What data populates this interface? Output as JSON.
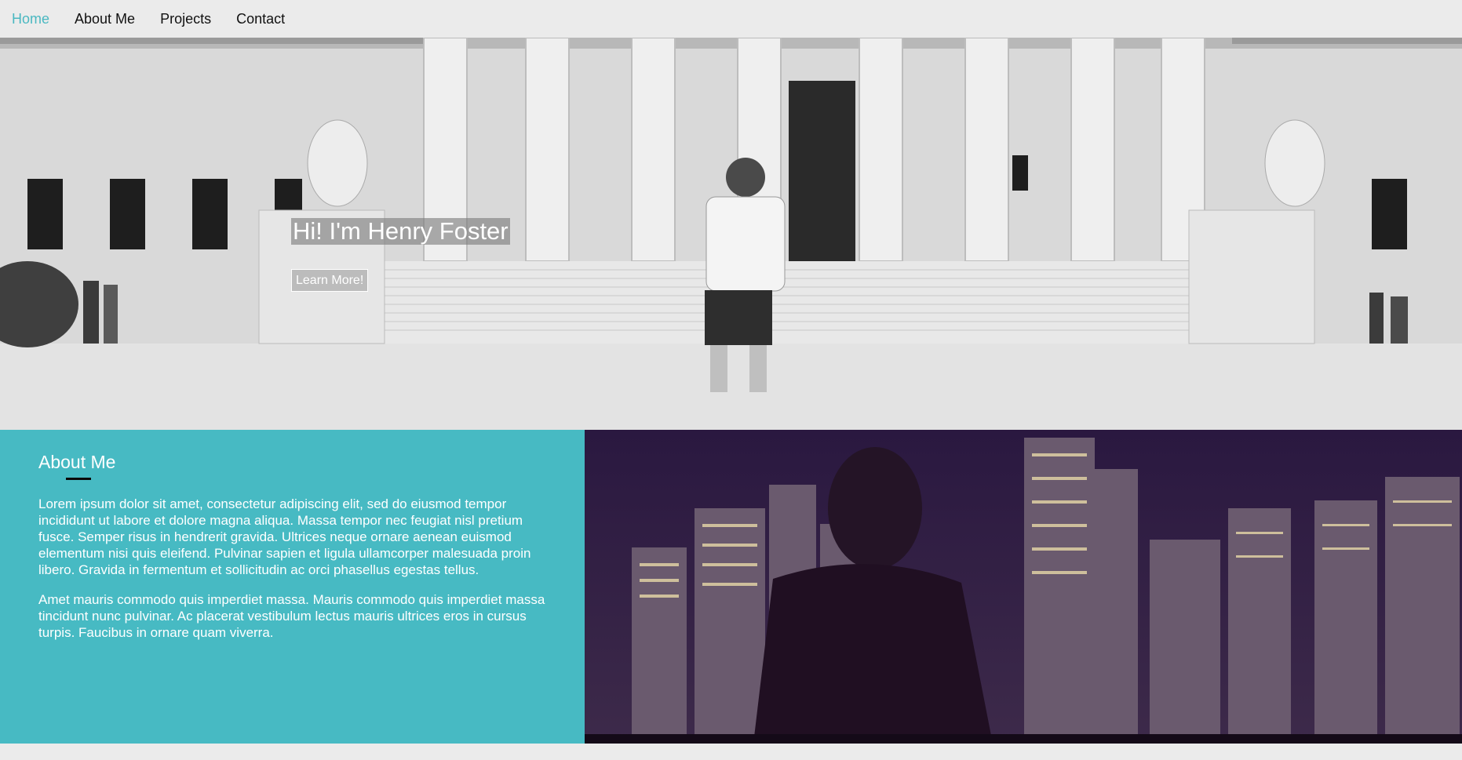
{
  "nav": {
    "items": [
      {
        "label": "Home",
        "active": true
      },
      {
        "label": "About Me",
        "active": false
      },
      {
        "label": "Projects",
        "active": false
      },
      {
        "label": "Contact",
        "active": false
      }
    ]
  },
  "hero": {
    "title": "Hi! I'm Henry Foster",
    "button_label": "Learn More!"
  },
  "about": {
    "heading": "About Me",
    "paragraphs": [
      "Lorem ipsum dolor sit amet, consectetur adipiscing elit, sed do eiusmod tempor incididunt ut labore et dolore magna aliqua. Massa tempor nec feugiat nisl pretium fusce. Semper risus in hendrerit gravida. Ultrices neque ornare aenean euismod elementum nisi quis eleifend. Pulvinar sapien et ligula ullamcorper malesuada proin libero. Gravida in fermentum et sollicitudin ac orci phasellus egestas tellus.",
      "Amet mauris commodo quis imperdiet massa. Mauris commodo quis imperdiet massa tincidunt nunc pulvinar. Ac placerat vestibulum lectus mauris ultrices eros in cursus turpis. Faucibus in ornare quam viverra."
    ]
  },
  "colors": {
    "accent": "#47bac3",
    "nav_active": "#4ab8c1",
    "background": "#ebebeb"
  }
}
